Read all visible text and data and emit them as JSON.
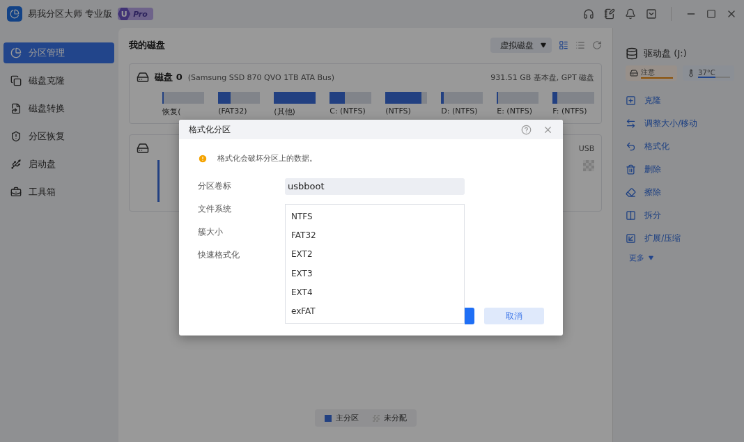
{
  "app": {
    "title": "易我分区大师 专业版",
    "badge_letter": "U",
    "badge": "Pro"
  },
  "sidebar": {
    "items": [
      {
        "label": "分区管理",
        "selected": true
      },
      {
        "label": "磁盘克隆",
        "selected": false
      },
      {
        "label": "磁盘转换",
        "selected": false
      },
      {
        "label": "分区恢复",
        "selected": false
      },
      {
        "label": "启动盘",
        "selected": false
      },
      {
        "label": "工具箱",
        "selected": false
      }
    ]
  },
  "main": {
    "title": "我的磁盘",
    "virtual_disk_button": "虚拟磁盘",
    "views": [
      {
        "selected": true
      },
      {
        "selected": false
      }
    ],
    "disks": [
      {
        "name": "磁盘 0",
        "detail": "(Samsung SSD 870 QVO 1TB ATA Bus)",
        "summary": "931.51 GB 基本盘, GPT 磁盘",
        "partitions": [
          {
            "kind": "primary",
            "label": "恢复(",
            "level": 0.03
          },
          {
            "kind": "primary",
            "label": "(FAT32)",
            "level": 0.3
          },
          {
            "kind": "primary",
            "label": "(其他)",
            "level": 1
          },
          {
            "kind": "primary",
            "label": "C: (NTFS)",
            "level": 0.36
          },
          {
            "kind": "primary",
            "label": "(NTFS)",
            "level": 0.86
          },
          {
            "kind": "primary",
            "label": "D: (NTFS)",
            "level": 0.06
          },
          {
            "kind": "primary",
            "label": "E: (NTFS)",
            "level": 0.03
          },
          {
            "kind": "primary",
            "label": "F: (NTFS)",
            "level": 0.12
          }
        ]
      },
      {
        "summary": "USB",
        "partitions": [
          {
            "kind": "primary"
          },
          {
            "kind": "unallocated"
          }
        ]
      }
    ],
    "legend": [
      {
        "kind": "primary",
        "label": "主分区"
      },
      {
        "kind": "unallocated",
        "label": "未分配"
      }
    ]
  },
  "right_panel": {
    "drive": "驱动盘 (J:)",
    "health": {
      "label": "注意",
      "level": 1
    },
    "temperature": {
      "label": "37°C",
      "level": 0.55
    },
    "actions": [
      "克隆",
      "调整大小/移动",
      "格式化",
      "删除",
      "擦除",
      "拆分",
      "扩展/压缩"
    ],
    "more": "更多"
  },
  "dialog": {
    "title": "格式化分区",
    "warning": "格式化会破坏分区上的数据。",
    "fields": [
      {
        "label": "分区卷标",
        "value": "usbboot"
      },
      {
        "label": "文件系统"
      },
      {
        "label": "簇大小"
      },
      {
        "label": "快速格式化"
      }
    ],
    "file_system_options": [
      "NTFS",
      "FAT32",
      "EXT2",
      "EXT3",
      "EXT4",
      "exFAT"
    ],
    "cancel": "取消"
  }
}
